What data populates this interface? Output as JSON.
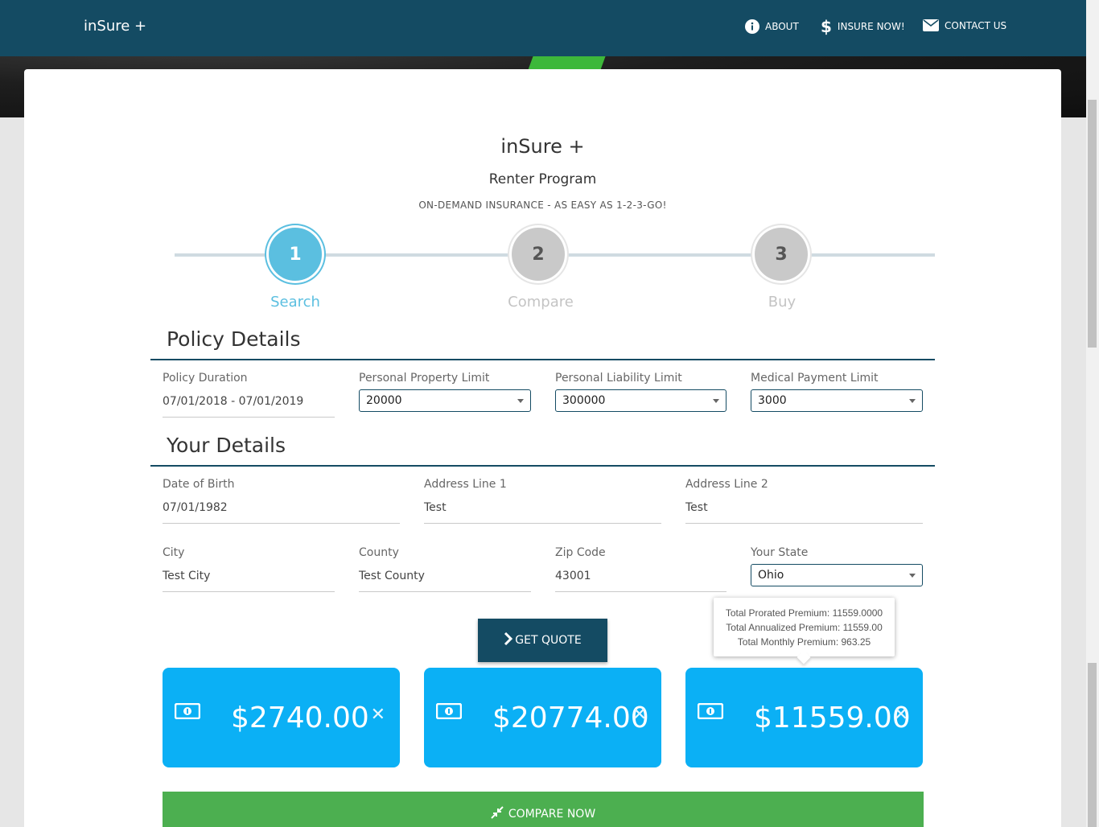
{
  "navbar": {
    "brand": "inSure +",
    "about": "ABOUT",
    "insure_now": "INSURE NOW!",
    "contact": "CONTACT US"
  },
  "header": {
    "title": "inSure +",
    "program": "Renter Program",
    "tagline": "ON-DEMAND INSURANCE - AS EASY AS 1-2-3-GO!"
  },
  "steps": [
    {
      "number": "1",
      "label": "Search",
      "active": true
    },
    {
      "number": "2",
      "label": "Compare",
      "active": false
    },
    {
      "number": "3",
      "label": "Buy",
      "active": false
    }
  ],
  "policy": {
    "heading": "Policy Details",
    "duration_label": "Policy Duration",
    "duration_value": "07/01/2018 - 07/01/2019",
    "property_label": "Personal Property Limit",
    "property_value": "20000",
    "liability_label": "Personal Liability Limit",
    "liability_value": "300000",
    "medical_label": "Medical Payment Limit",
    "medical_value": "3000"
  },
  "details": {
    "heading": "Your Details",
    "dob_label": "Date of Birth",
    "dob_value": "07/01/1982",
    "addr1_label": "Address Line 1",
    "addr1_value": "Test",
    "addr2_label": "Address Line 2",
    "addr2_value": "Test",
    "city_label": "City",
    "city_value": "Test City",
    "county_label": "County",
    "county_value": "Test County",
    "zip_label": "Zip Code",
    "zip_value": "43001",
    "state_label": "Your State",
    "state_value": "Ohio"
  },
  "tooltip": {
    "line1": "Total Prorated Premium: 11559.0000",
    "line2": "Total Annualized Premium: 11559.00",
    "line3": "Total Monthly Premium: 963.25"
  },
  "get_quote_label": "GET QUOTE",
  "quotes": [
    {
      "amount": "$2740.00"
    },
    {
      "amount": "$20774.00"
    },
    {
      "amount": "$11559.00"
    }
  ],
  "compare_label": "COMPARE NOW",
  "colors": {
    "navbar": "#144b63",
    "step_active": "#5bbfe0",
    "quote_card": "#0bb0f5",
    "compare_button": "#4caf50"
  }
}
